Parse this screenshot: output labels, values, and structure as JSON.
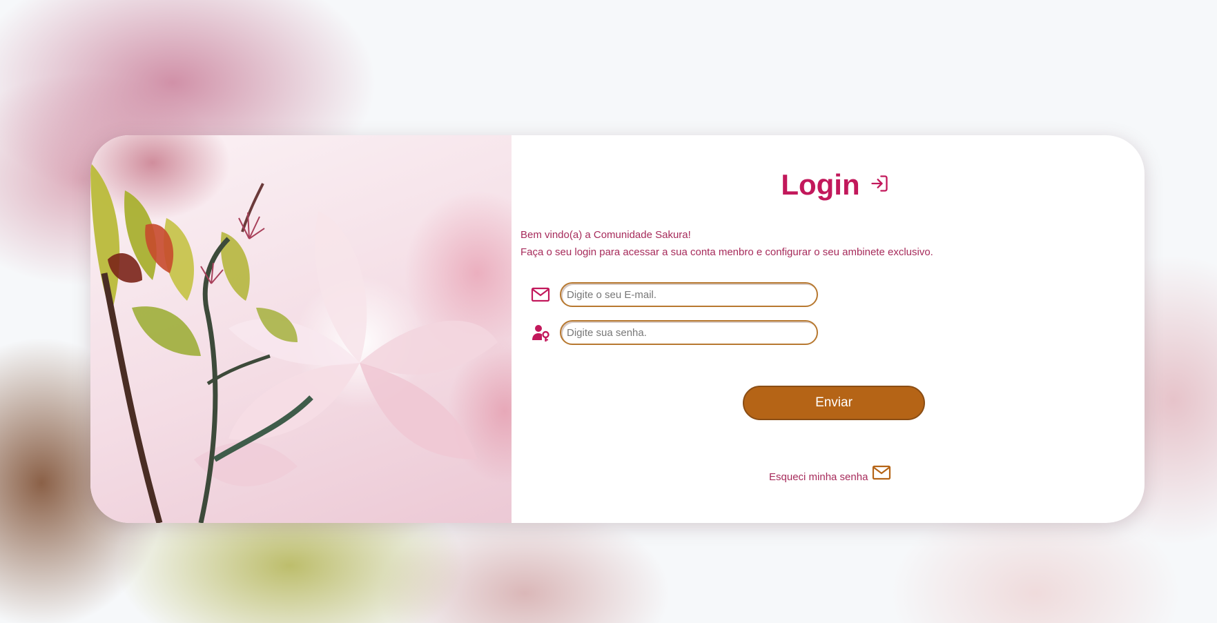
{
  "login": {
    "title": "Login",
    "intro_line1": "Bem vindo(a) a Comunidade Sakura!",
    "intro_line2": "Faça o seu login para acessar a sua conta menbro e configurar o seu ambinete exclusivo.",
    "email_placeholder": "Digite o seu E-mail.",
    "password_placeholder": "Digite sua senha.",
    "submit_label": "Enviar",
    "forgot_label": "Esqueci minha senha"
  },
  "colors": {
    "brand_pink": "#c2185b",
    "text_pink": "#a62a5a",
    "button_brown": "#b56416",
    "input_border": "#b7782f"
  },
  "icons": {
    "title": "login-arrow-icon",
    "email": "mail-icon",
    "password": "user-key-icon",
    "forgot": "mail-icon"
  }
}
